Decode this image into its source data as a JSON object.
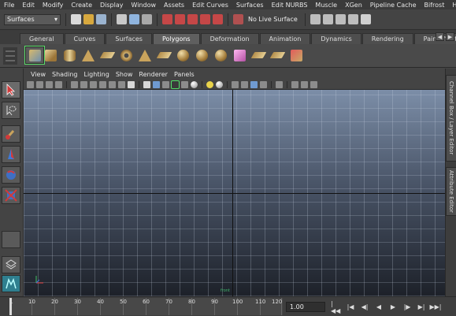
{
  "menubar": [
    "File",
    "Edit",
    "Modify",
    "Create",
    "Display",
    "Window",
    "Assets",
    "Edit Curves",
    "Surfaces",
    "Edit NURBS",
    "Muscle",
    "XGen",
    "Pipeline Cache",
    "Bifrost",
    "Help"
  ],
  "statusline": {
    "mode": "Surfaces",
    "live_label": "No Live Surface"
  },
  "shelf_tabs": [
    "General",
    "Curves",
    "Surfaces",
    "Polygons",
    "Deformation",
    "Animation",
    "Dynamics",
    "Rendering",
    "PaintEffects"
  ],
  "active_shelf_tab": "Polygons",
  "panel_menu": [
    "View",
    "Shading",
    "Lighting",
    "Show",
    "Renderer",
    "Panels"
  ],
  "side_tabs": [
    "Channel Box / Layer Editor",
    "Attribute Editor"
  ],
  "viewport": {
    "camera_label": "front"
  },
  "timeline": {
    "labels": [
      "10",
      "20",
      "30",
      "40",
      "50",
      "60",
      "70",
      "80",
      "90",
      "100",
      "110",
      "120"
    ],
    "current_frame": "1.00",
    "start_marker": "1"
  },
  "colors": {
    "accent_highlight": "#5cdc6a",
    "select_tool_red": "#d23a3a"
  }
}
